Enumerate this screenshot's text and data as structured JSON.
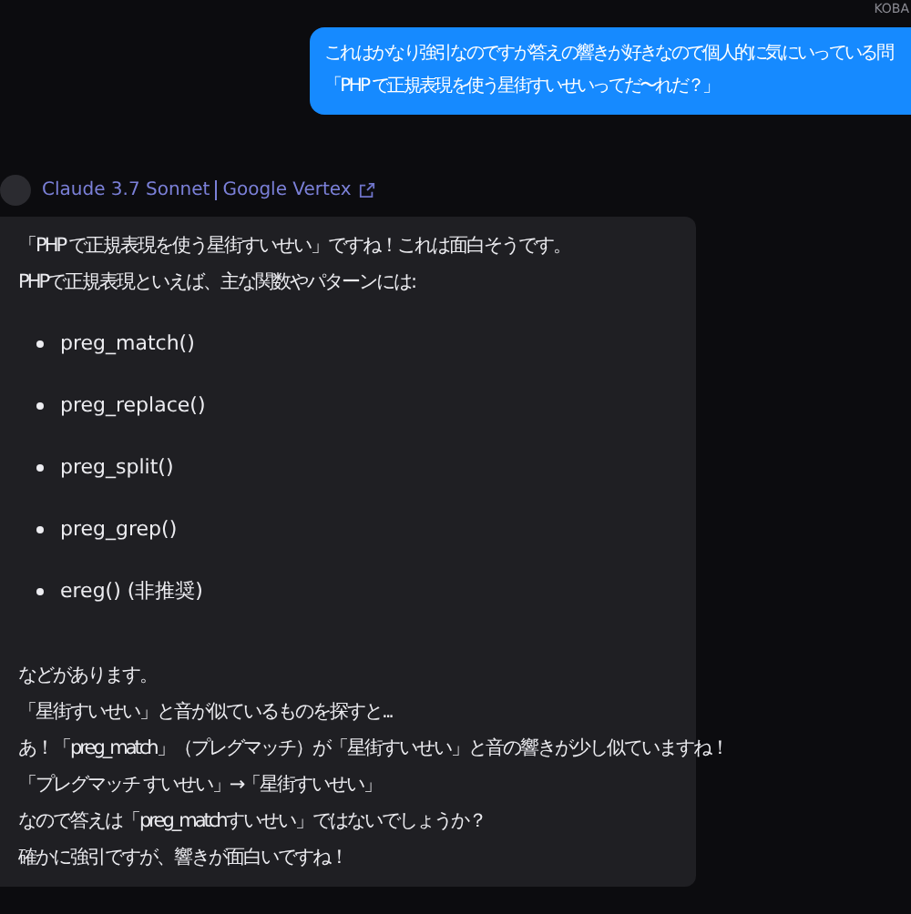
{
  "user_message": {
    "sender": "KOBA",
    "lines": [
      "これはかなり強引なのですが答えの響きが好きなので個人的に気にいっている問",
      "「PHP で正規表現を使う星街すいせいってだ〜れだ？」"
    ]
  },
  "response": {
    "model": "Claude 3.7 Sonnet",
    "provider": "Google Vertex",
    "intro": [
      "「PHP で正規表現を使う星街すいせい」ですね！これは面白そうです。",
      "PHPで正規表現といえば、主な関数やパターンには:"
    ],
    "bullets": [
      "preg_match()",
      "preg_replace()",
      "preg_split()",
      "preg_grep()",
      "ereg() (非推奨)"
    ],
    "outro": [
      "などがあります。",
      "「星街すいせい」と音が似ているものを探すと...",
      "あ！「preg_match」（プレグマッチ）が「星街すいせい」と音の響きが少し似ていますね！",
      "「プレグマッチ すいせい」→「星街すいせい」",
      "なので答えは「preg_matchすいせい」ではないでしょうか？",
      "確かに強引ですが、響きが面白いですね！"
    ]
  }
}
